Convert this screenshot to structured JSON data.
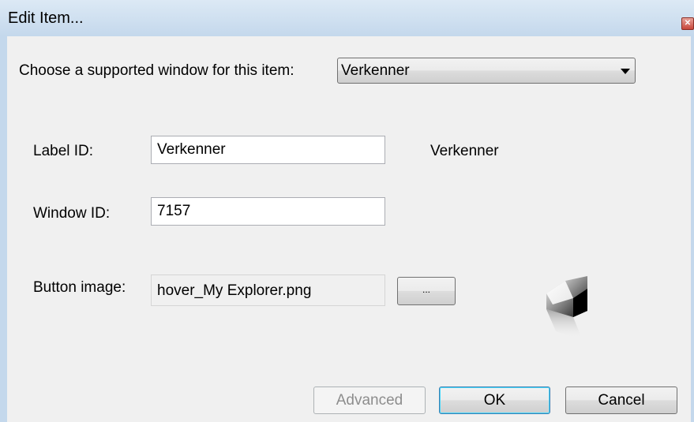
{
  "window": {
    "title": "Edit Item...",
    "close_glyph": "✕"
  },
  "form": {
    "window_prompt": "Choose a supported window for this item:",
    "window_select_value": "Verkenner",
    "label_id_label": "Label ID:",
    "label_id_value": "Verkenner",
    "label_preview": "Verkenner",
    "window_id_label": "Window ID:",
    "window_id_value": "7157",
    "button_image_label": "Button image:",
    "button_image_value": "hover_My Explorer.png",
    "browse_label": "...",
    "preview_icon": "explorer-folder-icon"
  },
  "buttons": {
    "advanced": "Advanced",
    "ok": "OK",
    "cancel": "Cancel"
  },
  "colors": {
    "titlebar": "#c4d8ec",
    "dialog_bg": "#f0f0f0",
    "default_button_border": "#3c7fb1"
  }
}
